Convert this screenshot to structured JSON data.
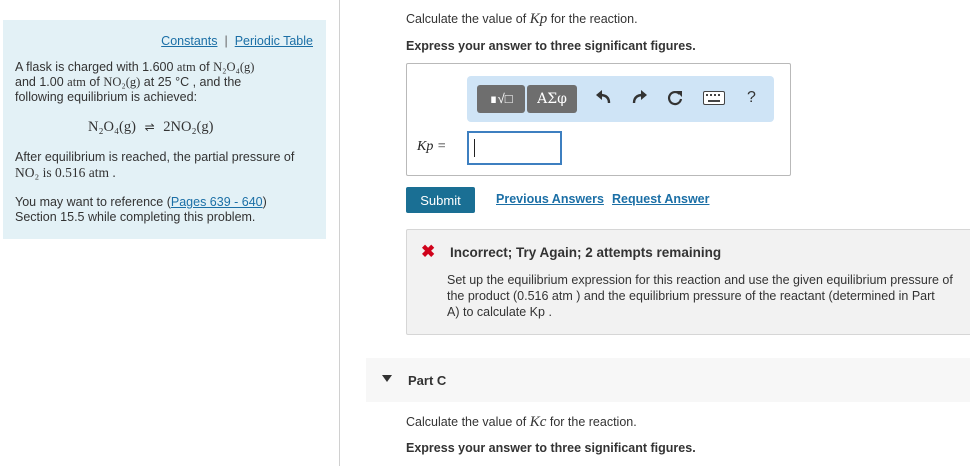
{
  "left_panel": {
    "link_constants": "Constants",
    "link_separator": "|",
    "link_periodic_table": "Periodic Table",
    "intro_a": "A flask is charged with 1.600",
    "intro_b": "atm",
    "intro_c": "of",
    "intro_d": "and 1.00",
    "intro_e": "atm",
    "intro_f": "of",
    "intro_g": "at 25 °C , and the",
    "intro_h": "following equilibrium is achieved:",
    "equation_left": "N₂O₄(g)",
    "equation_arrow": "⇌",
    "equation_right": "2NO₂(g)",
    "after_text": "After equilibrium is reached, the partial pressure of",
    "after_text_2": "NO₂ is 0.516 atm .",
    "ref_prefix": "You may want to reference (",
    "ref_link": "Pages 639 - 640",
    "ref_suffix": ")",
    "ref_line2": "Section 15.5 while completing this problem."
  },
  "chem": {
    "n2o4_g": "N₂O₄(g)",
    "no2_g": "NO₂(g)"
  },
  "question": {
    "prompt_prefix": "Calculate the value of",
    "prompt_var": "Kp",
    "prompt_suffix": "for the reaction.",
    "instruction": "Express your answer to three significant figures."
  },
  "toolbar": {
    "templates_label": "∎√□",
    "greek_label": "ΑΣφ",
    "help_label": "?"
  },
  "answer": {
    "label": "Kp =",
    "value": ""
  },
  "actions": {
    "submit": "Submit",
    "previous": "Previous Answers",
    "request": "Request Answer"
  },
  "feedback": {
    "icon": "x-icon",
    "title": "Incorrect; Try Again; 2 attempts remaining",
    "body_1": "Set up the equilibrium expression for this reaction and use the given equilibrium pressure of",
    "body_2": "the product (0.516 atm ) and the equilibrium pressure of the reactant (determined in Part",
    "body_3": "A) to calculate Kp ."
  },
  "part_c": {
    "label": "Part C",
    "prompt_prefix": "Calculate the value of",
    "prompt_var": "Kc",
    "prompt_suffix": "for the reaction.",
    "instruction": "Express your answer to three significant figures."
  },
  "colors": {
    "panel_bg": "#e3f1f6",
    "link": "#1b6fa6",
    "submit_bg": "#1a6f94",
    "toolbar_bg": "#cfe4f6",
    "error": "#d0021b"
  }
}
